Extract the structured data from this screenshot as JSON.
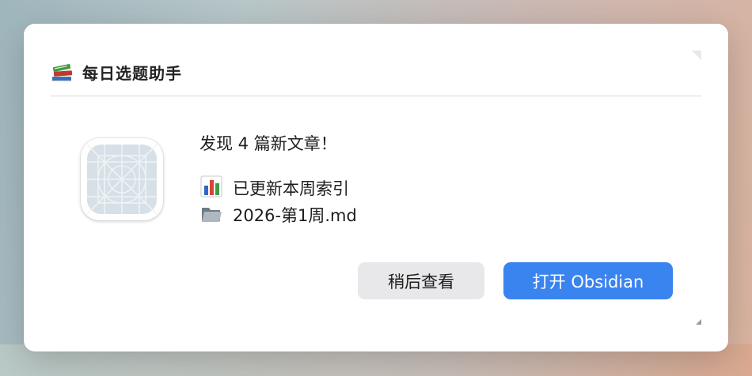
{
  "dialog": {
    "title": "每日选题助手",
    "title_icon": "books-emoji-icon",
    "app_icon": "generic-app-placeholder-icon"
  },
  "message": {
    "headline": "发现 4 篇新文章！",
    "lines": [
      {
        "icon": "bar-chart-emoji-icon",
        "text": "已更新本周索引"
      },
      {
        "icon": "open-folder-emoji-icon",
        "text": "2026-第1周.md"
      }
    ]
  },
  "buttons": {
    "later": "稍后查看",
    "open": "打开 Obsidian"
  },
  "colors": {
    "primary_button": "#3a84f0",
    "secondary_button": "#e8e8ea"
  }
}
